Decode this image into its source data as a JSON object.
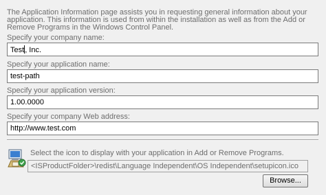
{
  "intro": "The Application Information page assists you in requesting general information about your application. This information is used from within the installation as well as from the Add or Remove Programs in the Windows Control Panel.",
  "company": {
    "label": "Specify your company name:",
    "value": "Test, Inc."
  },
  "app_name": {
    "label": "Specify your application name:",
    "value": "test-path"
  },
  "app_version": {
    "label": "Specify your application version:",
    "value": "1.00.0000"
  },
  "web_address": {
    "label": "Specify your company Web address:",
    "value": "http://www.test.com"
  },
  "icon_section": {
    "label": "Select the icon to display with your application in Add or Remove Programs.",
    "path": "<ISProductFolder>\\redist\\Language Independent\\OS Independent\\setupicon.ico",
    "icon": "setup-installer-icon"
  },
  "browse_label": "Browse..."
}
